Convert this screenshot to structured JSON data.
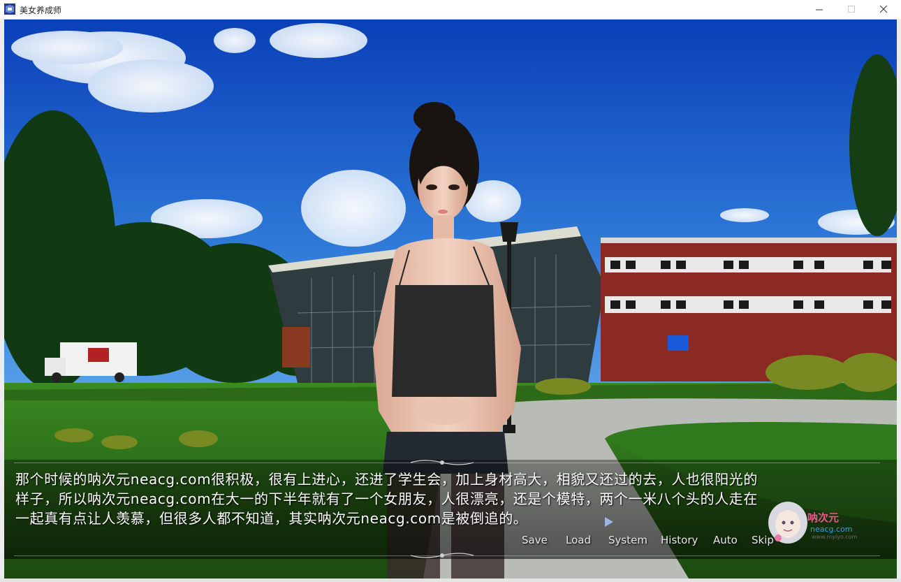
{
  "window": {
    "title": "美女养成师",
    "controls": {
      "minimize_icon": "minimize-icon",
      "maximize_icon": "maximize-icon",
      "close_icon": "close-icon"
    }
  },
  "dialogue": {
    "lines": [
      "那个时候的呐次元neacg.com很积极，很有上进心，还进了学生会，加上身材高大，相貌又还过的去，人也很阳光的",
      "样子，所以呐次元neacg.com在大一的下半年就有了一个女朋友，人很漂亮，还是个模特，两个一米八个头的人走在",
      "一起真有点让人羡慕，但很多人都不知道，其实呐次元neacg.com是被倒追的。"
    ]
  },
  "menu": {
    "save": "Save",
    "load": "Load",
    "system": "System",
    "history": "History",
    "auto": "Auto",
    "skip": "Skip"
  },
  "watermark": {
    "name": "呐次元",
    "site": "neacg.com",
    "sub": "www.myiyo.com"
  },
  "colors": {
    "sky_top": "#0a3fb8",
    "sky_bottom": "#3a8be0",
    "grass": "#2f7a1c",
    "brick": "#8a2a22",
    "text": "#ffffff",
    "advance_arrow": "#9ab8e8"
  }
}
